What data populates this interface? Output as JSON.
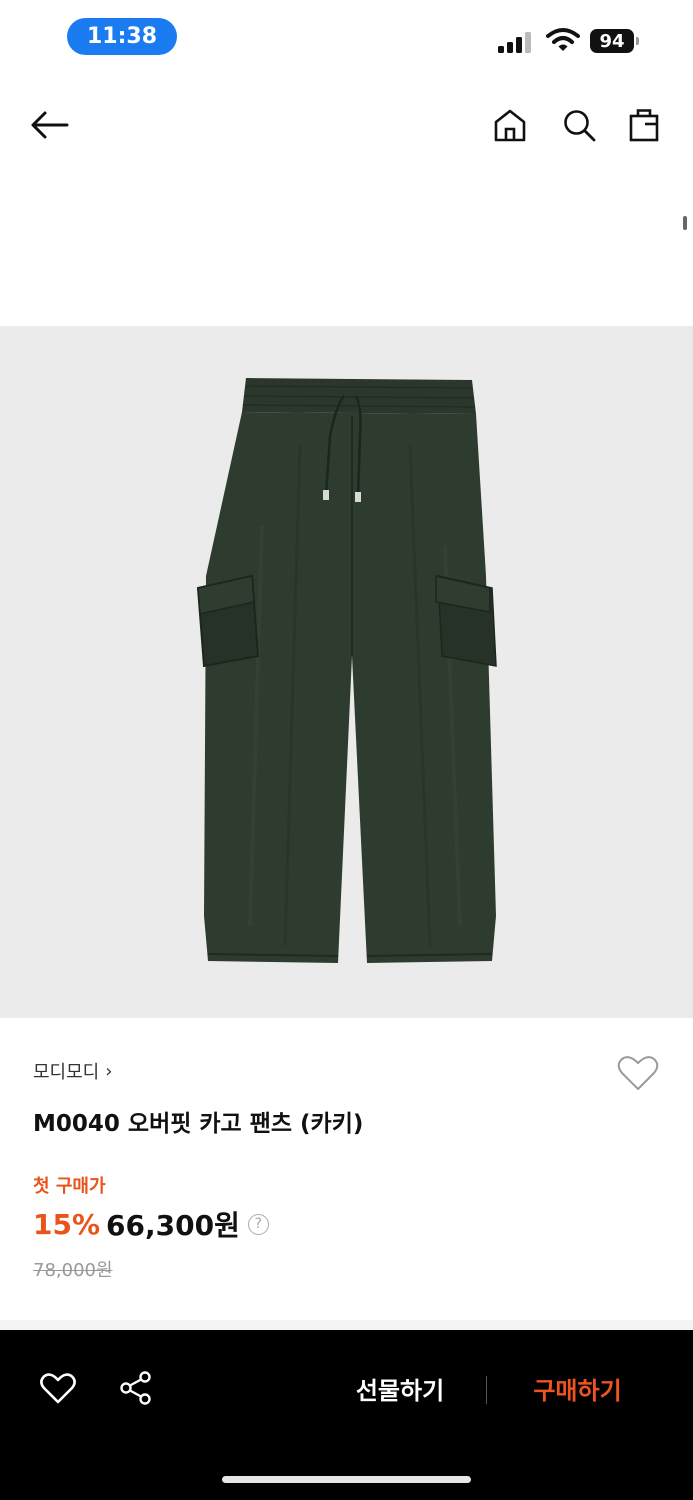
{
  "status_bar": {
    "time": "11:38",
    "battery": "94",
    "icons": [
      "signal-icon",
      "wifi-icon",
      "battery-icon"
    ]
  },
  "nav": {
    "icons": [
      "back-arrow-icon",
      "home-icon",
      "search-icon",
      "shopping-bag-icon"
    ]
  },
  "product": {
    "image_icon": "khaki-cargo-pants-photo",
    "brand": "모디모디",
    "brand_chevron": "›",
    "title": "M0040 오버핏 카고 팬츠 (카키)",
    "first_purchase_label": "첫 구매가",
    "discount": "15%",
    "price": "66,300원",
    "help": "?",
    "original_price": "78,000원"
  },
  "bottom_bar": {
    "gift_label": "선물하기",
    "buy_label": "구매하기",
    "icons": [
      "heart-icon",
      "share-icon"
    ]
  },
  "colors": {
    "accent": "#e8541a",
    "buy": "#f0541e",
    "time_pill": "#1a7cf0",
    "image_bg": "#ebebeb",
    "pants": "#2d3a2d"
  }
}
